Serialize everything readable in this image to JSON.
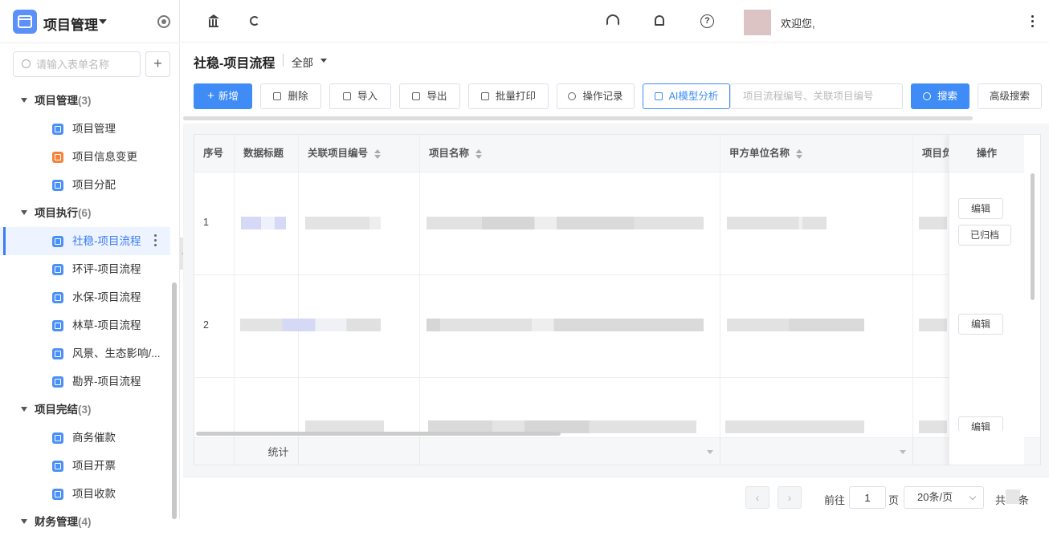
{
  "app": {
    "title": "项目管理"
  },
  "sidebar": {
    "search_placeholder": "请输入表单名称",
    "add_label": "+",
    "groups": [
      {
        "label": "项目管理",
        "count": "(3)",
        "items": [
          "项目管理",
          "项目信息变更",
          "项目分配"
        ]
      },
      {
        "label": "项目执行",
        "count": "(6)",
        "items": [
          "社稳-项目流程",
          "环评-项目流程",
          "水保-项目流程",
          "林草-项目流程",
          "风景、生态影响/...",
          "勘界-项目流程"
        ]
      },
      {
        "label": "项目完结",
        "count": "(3)",
        "items": [
          "商务催款",
          "项目开票",
          "项目收款"
        ]
      },
      {
        "label": "财务管理",
        "count": "(4)"
      }
    ]
  },
  "topbar": {
    "welcome": "欢迎您,"
  },
  "page": {
    "title": "社稳-项目流程",
    "filter": "全部"
  },
  "toolbar": {
    "new": "新增",
    "delete": "删除",
    "import": "导入",
    "export": "导出",
    "batch_print": "批量打印",
    "op_log": "操作记录",
    "ai": "AI模型分析",
    "search_placeholder": "项目流程编号、关联项目编号",
    "search": "搜索",
    "advanced": "高级搜索"
  },
  "table": {
    "columns": [
      "序号",
      "数据标题",
      "关联项目编号",
      "项目名称",
      "甲方单位名称",
      "项目负",
      "操作"
    ],
    "rows": [
      {
        "index": "1",
        "actions": [
          "编辑",
          "已归档"
        ]
      },
      {
        "index": "2",
        "actions": [
          "编辑"
        ]
      },
      {
        "index": "",
        "actions": [
          "编辑"
        ]
      }
    ],
    "summary_label": "统计"
  },
  "pagination": {
    "prev": "‹",
    "next": "›",
    "goto": "前往",
    "page": "1",
    "page_unit": "页",
    "page_size": "20条/页",
    "total_prefix": "共",
    "total_suffix": "条"
  },
  "colors": {
    "primary": "#3f8cf7",
    "accent_orange": "#f5833b"
  },
  "icons": [
    "app-icon",
    "gear-icon",
    "search-icon",
    "bank-icon",
    "refresh-icon",
    "headset-icon",
    "bell-icon",
    "help-icon",
    "more-icon",
    "plus-icon",
    "trash-icon",
    "import-icon",
    "export-icon",
    "print-icon",
    "clock-icon",
    "robot-icon"
  ]
}
